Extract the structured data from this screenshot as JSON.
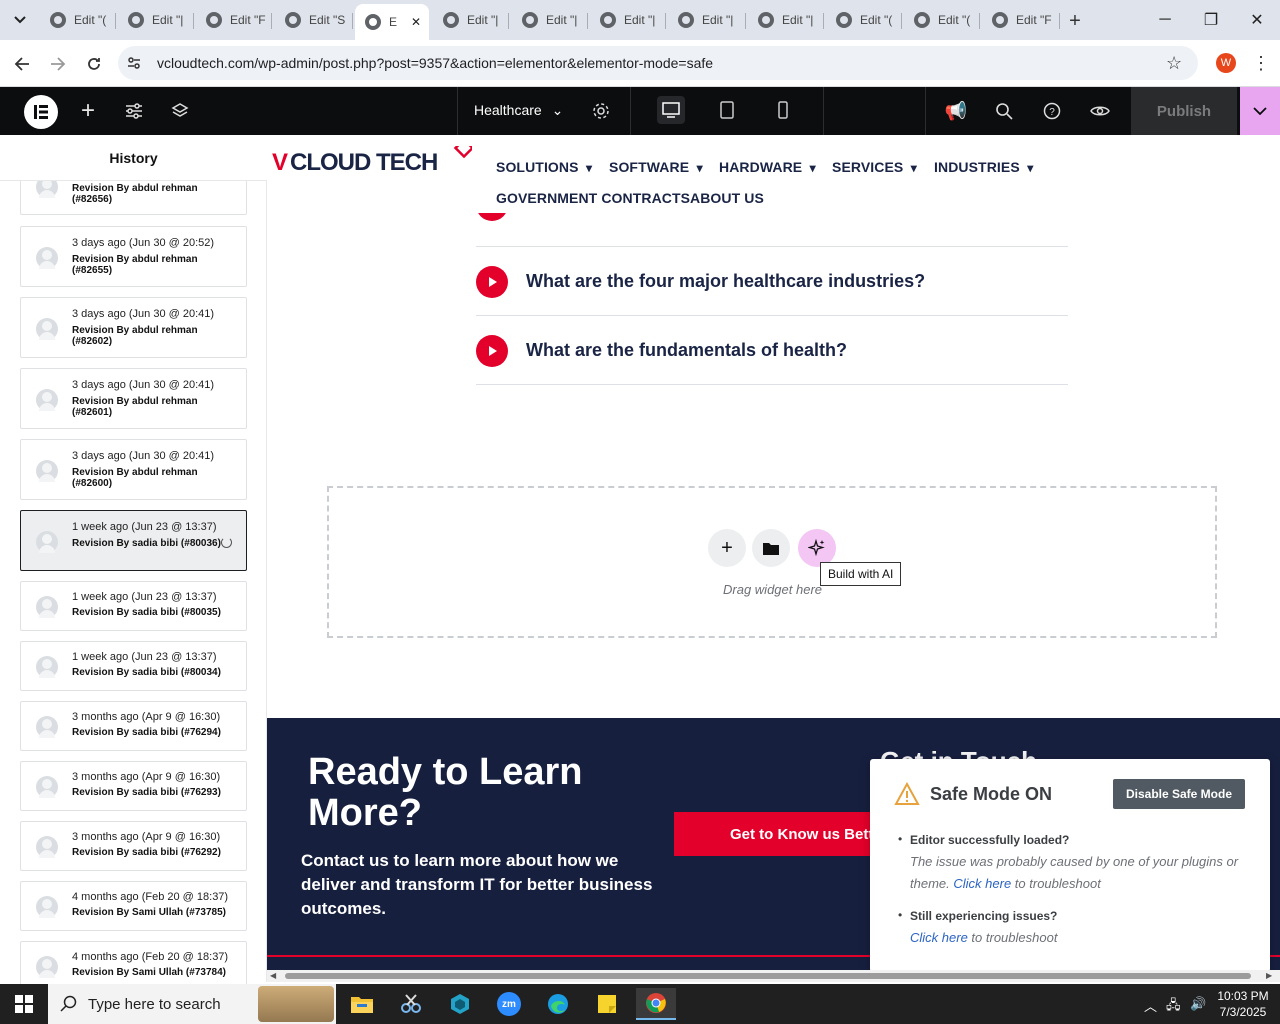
{
  "browser": {
    "tabs": [
      {
        "label": "Edit \"("
      },
      {
        "label": "Edit \"|"
      },
      {
        "label": "Edit \"F"
      },
      {
        "label": "Edit \"S"
      },
      {
        "label": "E"
      },
      {
        "label": "Edit \"|"
      },
      {
        "label": "Edit \"|"
      },
      {
        "label": "Edit \"|"
      },
      {
        "label": "Edit \"|"
      },
      {
        "label": "Edit \"|"
      },
      {
        "label": "Edit \"("
      },
      {
        "label": "Edit \"("
      },
      {
        "label": "Edit \"F"
      }
    ],
    "url": "vcloudtech.com/wp-admin/post.php?post=9357&action=elementor&elementor-mode=safe",
    "profile_initial": "W"
  },
  "editor": {
    "page_name": "Healthcare",
    "publish_label": "Publish",
    "accent": "#e9a6f0"
  },
  "history": {
    "title": "History",
    "items": [
      {
        "time": "",
        "by": "Revision By abdul rehman (#82656)"
      },
      {
        "time": "3 days ago (Jun 30 @ 20:52)",
        "by": "Revision By abdul rehman (#82655)"
      },
      {
        "time": "3 days ago (Jun 30 @ 20:41)",
        "by": "Revision By abdul rehman (#82602)"
      },
      {
        "time": "3 days ago (Jun 30 @ 20:41)",
        "by": "Revision By abdul rehman (#82601)"
      },
      {
        "time": "3 days ago (Jun 30 @ 20:41)",
        "by": "Revision By abdul rehman (#82600)"
      },
      {
        "time": "1 week ago (Jun 23 @ 13:37)",
        "by": "Revision By sadia bibi (#80036)"
      },
      {
        "time": "1 week ago (Jun 23 @ 13:37)",
        "by": "Revision By sadia bibi (#80035)"
      },
      {
        "time": "1 week ago (Jun 23 @ 13:37)",
        "by": "Revision By sadia bibi (#80034)"
      },
      {
        "time": "3 months ago (Apr 9 @ 16:30)",
        "by": "Revision By sadia bibi (#76294)"
      },
      {
        "time": "3 months ago (Apr 9 @ 16:30)",
        "by": "Revision By sadia bibi (#76293)"
      },
      {
        "time": "3 months ago (Apr 9 @ 16:30)",
        "by": "Revision By sadia bibi (#76292)"
      },
      {
        "time": "4 months ago (Feb 20 @ 18:37)",
        "by": "Revision By Sami Ullah (#73785)"
      },
      {
        "time": "4 months ago (Feb 20 @ 18:37)",
        "by": "Revision By Sami Ullah (#73784)"
      }
    ]
  },
  "site": {
    "logo_text": "VCLOUD TECH",
    "menu": [
      "SOLUTIONS",
      "SOFTWARE",
      "HARDWARE",
      "SERVICES",
      "INDUSTRIES",
      "GOVERNMENT CONTRACTS",
      "ABOUT US"
    ],
    "faq": [
      "What are the four major healthcare industries?",
      "What are the fundamentals of health?"
    ],
    "dropzone_hint": "Drag widget here",
    "ai_tooltip": "Build with AI",
    "cta_title": "Ready to Learn More?",
    "cta_text": "Contact us to learn more about how we deliver and transform IT for better business outcomes.",
    "cta_button": "Get to Know us Better",
    "cta_side_heading": "Get in Touch",
    "brand_red": "#e3002b",
    "navy": "#171f3f"
  },
  "safe_mode": {
    "title": "Safe Mode ON",
    "disable_label": "Disable Safe Mode",
    "q1": "Editor successfully loaded?",
    "a1_pre": "The issue was probably caused by one of your plugins or theme.",
    "a1_link": "Click here",
    "a1_post": "to troubleshoot",
    "q2": "Still experiencing issues?",
    "a2_link": "Click here",
    "a2_post": "to troubleshoot"
  },
  "taskbar": {
    "search_placeholder": "Type here to search",
    "time": "10:03 PM",
    "date": "7/3/2025"
  }
}
